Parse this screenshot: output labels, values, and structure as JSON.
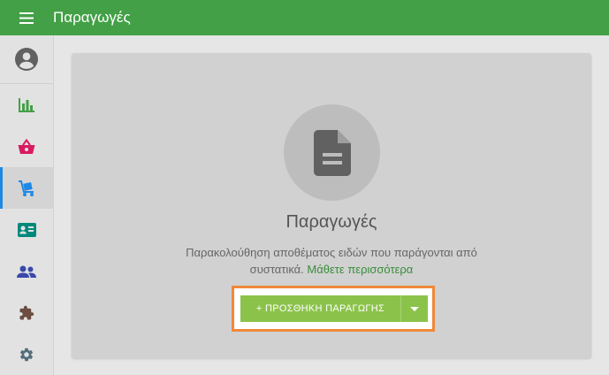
{
  "header": {
    "title": "Παραγωγές",
    "menu_icon": "hamburger-menu-icon",
    "background_color": "#43a047"
  },
  "sidebar": {
    "items": [
      {
        "id": "profile",
        "icon": "account-circle-icon",
        "color": "#616161"
      },
      {
        "id": "reports",
        "icon": "bar-chart-icon",
        "color": "#43a047"
      },
      {
        "id": "sales",
        "icon": "shopping-basket-icon",
        "color": "#d81b60"
      },
      {
        "id": "productions",
        "icon": "dolly-cart-icon",
        "color": "#1e88e5",
        "active": true
      },
      {
        "id": "contacts",
        "icon": "contact-card-icon",
        "color": "#00897b"
      },
      {
        "id": "users",
        "icon": "people-icon",
        "color": "#3949ab"
      },
      {
        "id": "apps",
        "icon": "puzzle-piece-icon",
        "color": "#6d4c41"
      },
      {
        "id": "settings",
        "icon": "gear-icon",
        "color": "#546e7a"
      }
    ]
  },
  "empty_state": {
    "icon": "document-icon",
    "title": "Παραγωγές",
    "description": "Παρακολούθηση αποθέματος ειδών που παράγονται από συστατικά.",
    "learn_more": "Μάθετε περισσότερα",
    "add_button_label": "+ ΠΡΟΣΘΗΚΗ ΠΑΡΑΓΩΓΗΣ",
    "dropdown_icon": "caret-down-icon",
    "button_color": "#8bc34a",
    "highlight_color": "#f0883a"
  }
}
